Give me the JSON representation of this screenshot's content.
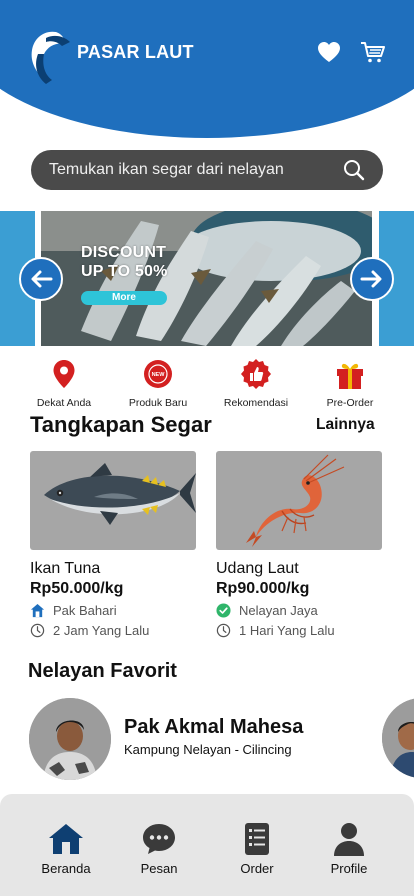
{
  "app": {
    "title": "PASAR LAUT"
  },
  "header": {
    "favorites_icon": "heart-icon",
    "cart_icon": "cart-icon"
  },
  "search": {
    "placeholder": "Temukan ikan segar dari nelayan",
    "icon": "search-icon"
  },
  "banner": {
    "promo_line1": "DISCOUNT",
    "promo_line2": "UP TO 50%",
    "promo_button": "More"
  },
  "categories": [
    {
      "label": "Dekat Anda",
      "icon": "location-pin-icon"
    },
    {
      "label": "Produk Baru",
      "icon": "new-badge-icon"
    },
    {
      "label": "Rekomendasi",
      "icon": "thumbs-up-icon"
    },
    {
      "label": "Pre-Order",
      "icon": "gift-icon"
    }
  ],
  "fresh_catch": {
    "title": "Tangkapan Segar",
    "see_more": "Lainnya",
    "products": [
      {
        "name": "Ikan Tuna",
        "price": "Rp50.000/kg",
        "seller": "Pak Bahari",
        "time": "2 Jam Yang Lalu",
        "image": "tuna-image"
      },
      {
        "name": "Udang Laut",
        "price": "Rp90.000/kg",
        "seller": "Nelayan Jaya",
        "time": "1 Hari Yang Lalu",
        "image": "shrimp-image"
      }
    ]
  },
  "favorite_fishers": {
    "title": "Nelayan Favorit",
    "items": [
      {
        "name": "Pak Akmal Mahesa",
        "location": "Kampung Nelayan - Cilincing"
      }
    ]
  },
  "bottom_nav": [
    {
      "label": "Beranda",
      "icon": "home-icon",
      "active": true
    },
    {
      "label": "Pesan",
      "icon": "chat-icon"
    },
    {
      "label": "Order",
      "icon": "order-list-icon"
    },
    {
      "label": "Profile",
      "icon": "user-icon"
    }
  ],
  "colors": {
    "primary": "#1f6fbd",
    "accent": "#2ec4d8",
    "search_bg": "#4a4a4a",
    "nav_bg": "#e6e6e6",
    "badge_red": "#d32020"
  }
}
